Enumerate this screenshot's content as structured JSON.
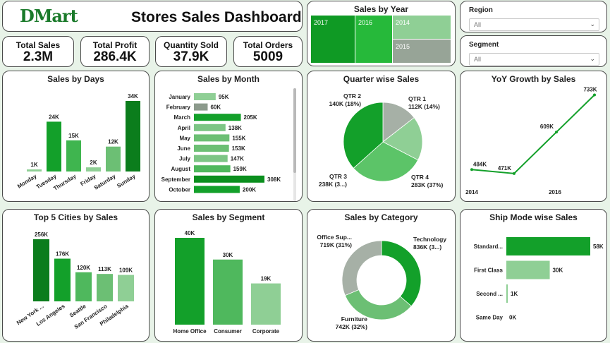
{
  "header": {
    "logo_text": "DMart",
    "title": "Stores Sales Dashboard"
  },
  "kpis": [
    {
      "label": "Total Sales",
      "value": "2.3M"
    },
    {
      "label": "Total Profit",
      "value": "286.4K"
    },
    {
      "label": "Quantity Sold",
      "value": "37.9K"
    },
    {
      "label": "Total Orders",
      "value": "5009"
    }
  ],
  "slicers": {
    "region": {
      "label": "Region",
      "value": "All"
    },
    "segment": {
      "label": "Segment",
      "value": "All"
    }
  },
  "colors": {
    "dark_green": "#0b7d1c",
    "green": "#13a02a",
    "mid_green": "#3fb54f",
    "light_green": "#8fcf95",
    "pale_green": "#a7d9ab",
    "gray": "#8c9a8c"
  },
  "titles": {
    "sales_by_year": "Sales by Year",
    "sales_by_days": "Sales by Days",
    "sales_by_month": "Sales by Month",
    "quarter": "Quarter wise Sales",
    "yoy": "YoY Growth by Sales",
    "cities": "Top 5 Cities by Sales",
    "segment": "Sales by Segment",
    "category": "Sales by Category",
    "shipmode": "Ship Mode wise Sales"
  },
  "chart_data": [
    {
      "id": "sales_by_year",
      "type": "treemap",
      "title": "Sales by Year",
      "categories": [
        "2017",
        "2016",
        "2014",
        "2015"
      ],
      "colors": [
        "#0f9a24",
        "#26b93a",
        "#8fcf95",
        "#97a497"
      ]
    },
    {
      "id": "sales_by_days",
      "type": "bar",
      "title": "Sales by Days",
      "categories": [
        "Monday",
        "Tuesday",
        "Thursday",
        "Friday",
        "Saturday",
        "Sunday"
      ],
      "values": [
        1,
        24,
        15,
        2,
        12,
        34
      ],
      "labels": [
        "1K",
        "24K",
        "15K",
        "2K",
        "12K",
        "34K"
      ],
      "colors": [
        "#8fcf95",
        "#13a02a",
        "#3fb54f",
        "#8fcf95",
        "#6cbf74",
        "#0b7d1c"
      ]
    },
    {
      "id": "sales_by_month",
      "type": "bar",
      "orientation": "horizontal",
      "title": "Sales by Month",
      "categories": [
        "January",
        "February",
        "March",
        "April",
        "May",
        "June",
        "July",
        "August",
        "September",
        "October"
      ],
      "values": [
        95,
        60,
        205,
        138,
        155,
        153,
        147,
        159,
        308,
        200
      ],
      "labels": [
        "95K",
        "60K",
        "205K",
        "138K",
        "155K",
        "153K",
        "147K",
        "159K",
        "308K",
        "200K"
      ],
      "colors": [
        "#8fcf95",
        "#8c9a8c",
        "#13a02a",
        "#7dc585",
        "#6cbf74",
        "#6cbf74",
        "#7dc585",
        "#4fb85d",
        "#0b8f1e",
        "#13a02a"
      ]
    },
    {
      "id": "quarter",
      "type": "pie",
      "title": "Quarter wise Sales",
      "categories": [
        "QTR 1",
        "QTR 2",
        "QTR 3",
        "QTR 4"
      ],
      "values": [
        112,
        140,
        238,
        283
      ],
      "labels": [
        "112K (14%)",
        "140K (18%)",
        "238K (3...)",
        "283K (37%)"
      ],
      "colors": [
        "#a6b0a6",
        "#8fcf95",
        "#5cc468",
        "#13a02a"
      ]
    },
    {
      "id": "yoy",
      "type": "line",
      "title": "YoY Growth by Sales",
      "x": [
        2014,
        2015,
        2016,
        2017
      ],
      "values": [
        484,
        471,
        609,
        733
      ],
      "labels": [
        "484K",
        "471K",
        "609K",
        "733K"
      ],
      "tick_labels": [
        "2014",
        "2016"
      ],
      "color": "#13a02a"
    },
    {
      "id": "cities",
      "type": "bar",
      "title": "Top 5 Cities by Sales",
      "categories": [
        "New York ...",
        "Los Angeles",
        "Seattle",
        "San Francisco",
        "Philadelphia"
      ],
      "values": [
        256,
        176,
        120,
        113,
        109
      ],
      "labels": [
        "256K",
        "176K",
        "120K",
        "113K",
        "109K"
      ],
      "colors": [
        "#0b7d1c",
        "#13a02a",
        "#4fb85d",
        "#6cbf74",
        "#8fcf95"
      ]
    },
    {
      "id": "segment",
      "type": "bar",
      "title": "Sales by Segment",
      "categories": [
        "Home Office",
        "Consumer",
        "Corporate"
      ],
      "values": [
        40,
        30,
        19
      ],
      "labels": [
        "40K",
        "30K",
        "19K"
      ],
      "colors": [
        "#13a02a",
        "#4fb85d",
        "#8fcf95"
      ]
    },
    {
      "id": "category",
      "type": "donut",
      "title": "Sales by Category",
      "categories": [
        "Technology",
        "Furniture",
        "Office Sup..."
      ],
      "values": [
        836,
        742,
        719
      ],
      "labels": [
        "836K (3...)",
        "742K (32%)",
        "719K (31%)"
      ],
      "colors": [
        "#13a02a",
        "#6cbf74",
        "#a6b0a6"
      ]
    },
    {
      "id": "shipmode",
      "type": "bar",
      "orientation": "horizontal",
      "title": "Ship Mode wise Sales",
      "categories": [
        "Standard...",
        "First Class",
        "Second ...",
        "Same Day"
      ],
      "values": [
        58,
        30,
        1,
        0
      ],
      "labels": [
        "58K",
        "30K",
        "1K",
        "0K"
      ],
      "colors": [
        "#13a02a",
        "#8fcf95",
        "#8fcf95",
        "#8fcf95"
      ]
    }
  ]
}
